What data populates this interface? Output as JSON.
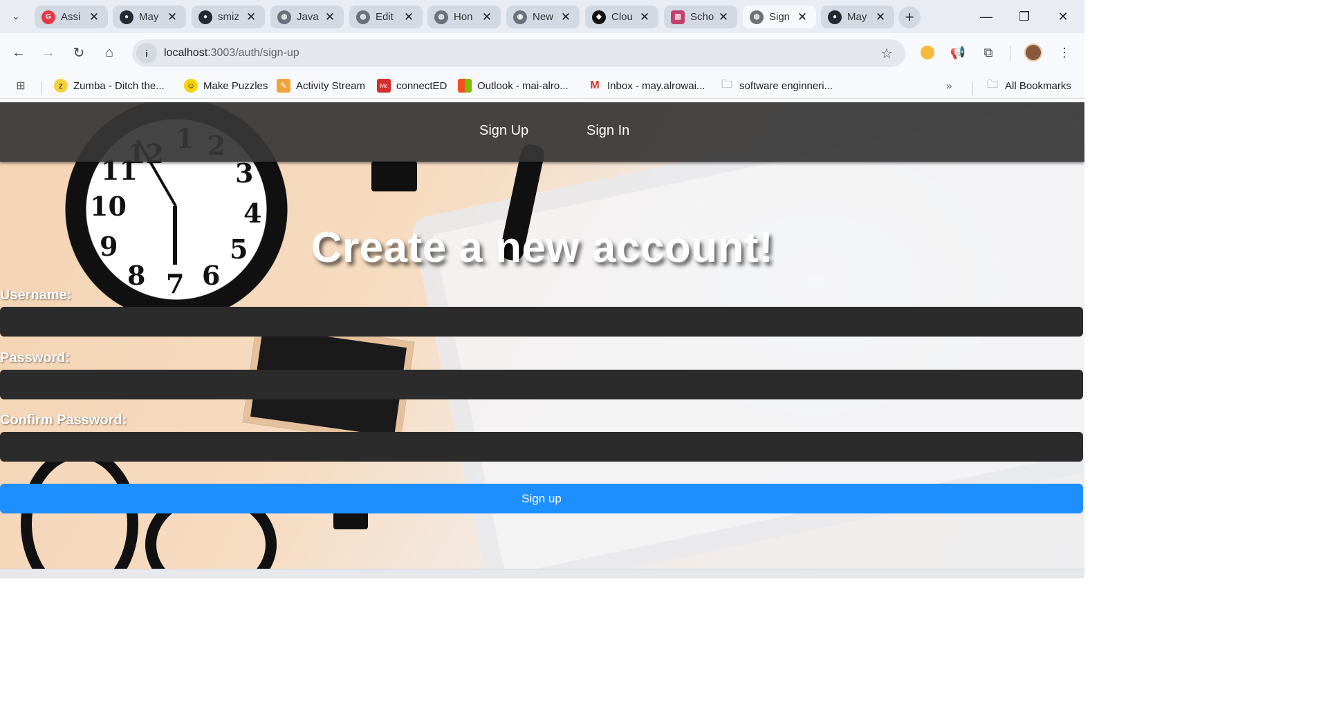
{
  "browser": {
    "tabs": [
      {
        "title": "Assi",
        "icon": "red-badge-icon",
        "color": "#e53946",
        "active": false
      },
      {
        "title": "May",
        "icon": "github-icon",
        "color": "#24292f",
        "active": false
      },
      {
        "title": "smiz",
        "icon": "github-icon",
        "color": "#24292f",
        "active": false
      },
      {
        "title": "Java",
        "icon": "globe-icon",
        "color": "#5f6368",
        "active": false
      },
      {
        "title": "Edit",
        "icon": "globe-icon",
        "color": "#5f6368",
        "active": false
      },
      {
        "title": "Hon",
        "icon": "globe-icon",
        "color": "#5f6368",
        "active": false
      },
      {
        "title": "New",
        "icon": "chrome-icon",
        "color": "#5f6368",
        "active": false
      },
      {
        "title": "Clou",
        "icon": "cloud-icon",
        "color": "#111111",
        "active": false
      },
      {
        "title": "Scho",
        "icon": "trello-icon",
        "color": "#c2406f",
        "active": false
      },
      {
        "title": "Sign",
        "icon": "globe-icon",
        "color": "#5f6368",
        "active": true
      },
      {
        "title": "May",
        "icon": "github-icon",
        "color": "#24292f",
        "active": false
      }
    ],
    "url_host": "localhost",
    "url_path": ":3003/auth/sign-up",
    "bookmarks": [
      {
        "label": "Zumba - Ditch the...",
        "icon": "zumba-icon"
      },
      {
        "label": "Make Puzzles",
        "icon": "smiley-icon"
      },
      {
        "label": "Activity Stream",
        "icon": "pencil-icon"
      },
      {
        "label": "connectED",
        "icon": "mcgraw-hill-icon"
      },
      {
        "label": "Outlook - mai-alro...",
        "icon": "microsoft-icon"
      },
      {
        "label": "Inbox - may.alrowai...",
        "icon": "gmail-icon"
      },
      {
        "label": "software enginneri...",
        "icon": "folder-icon"
      }
    ],
    "all_bookmarks_label": "All Bookmarks"
  },
  "page": {
    "nav": {
      "sign_up": "Sign Up",
      "sign_in": "Sign In"
    },
    "heading": "Create a new account!",
    "form": {
      "username_label": "Username:",
      "username_value": "",
      "password_label": "Password:",
      "password_value": "",
      "confirm_label": "Confirm Password:",
      "confirm_value": "",
      "submit_label": "Sign up"
    },
    "colors": {
      "navbar": "#373737",
      "input": "#2b2b2b",
      "button": "#1e8fff"
    }
  }
}
